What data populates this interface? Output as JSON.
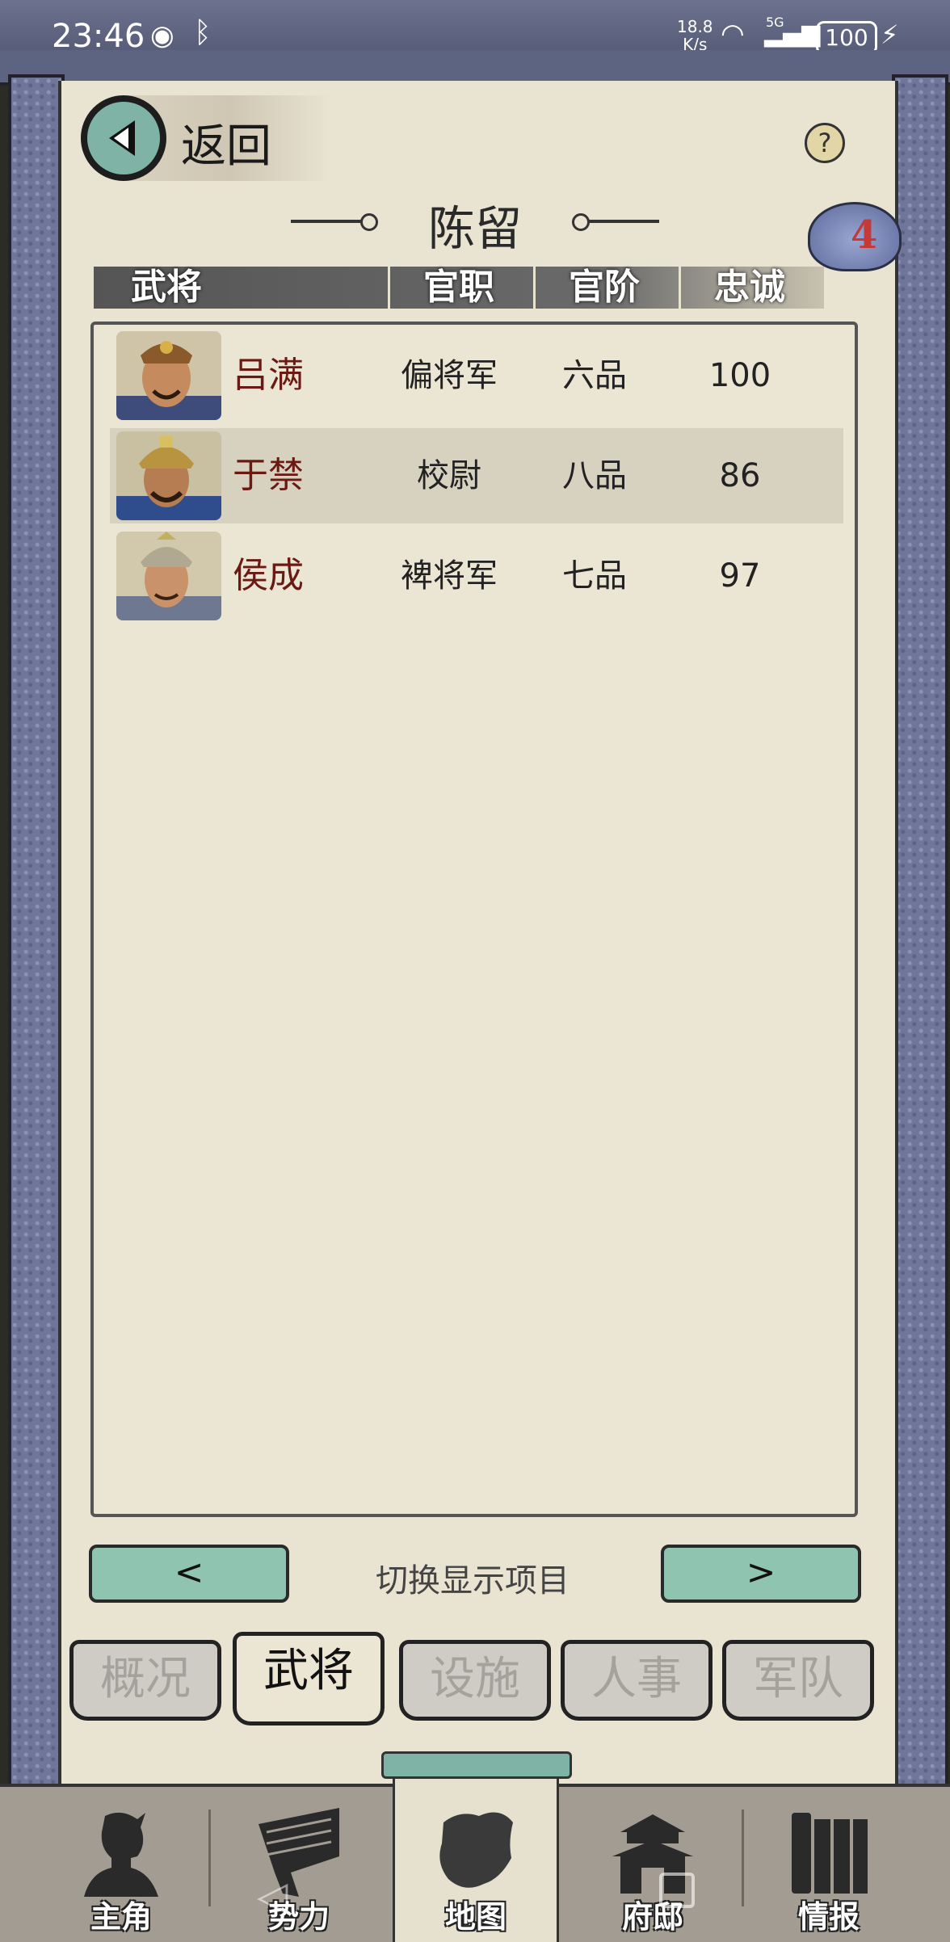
{
  "status_bar": {
    "time": "23:46",
    "net_speed_value": "18.8",
    "net_speed_unit": "K/s",
    "signal_label": "5G",
    "battery": "100"
  },
  "header": {
    "back_label": "返回",
    "help_symbol": "?",
    "city_name": "陈留",
    "badge_count": "4"
  },
  "table": {
    "headers": {
      "general": "武将",
      "post": "官职",
      "rank": "官阶",
      "loyalty": "忠诚"
    },
    "rows": [
      {
        "name": "吕满",
        "post": "偏将军",
        "rank": "六品",
        "loyalty": "100"
      },
      {
        "name": "于禁",
        "post": "校尉",
        "rank": "八品",
        "loyalty": "86"
      },
      {
        "name": "侯成",
        "post": "裨将军",
        "rank": "七品",
        "loyalty": "97"
      }
    ]
  },
  "pager": {
    "prev": "<",
    "next": ">",
    "label": "切换显示项目"
  },
  "tabs": [
    {
      "label": "概况"
    },
    {
      "label": "武将"
    },
    {
      "label": "设施"
    },
    {
      "label": "人事"
    },
    {
      "label": "军队"
    }
  ],
  "bottom_nav": [
    {
      "label": "主角",
      "icon": "hero-icon"
    },
    {
      "label": "势力",
      "icon": "banner-icon"
    },
    {
      "label": "地图",
      "icon": "map-icon"
    },
    {
      "label": "府邸",
      "icon": "mansion-icon"
    },
    {
      "label": "情报",
      "icon": "scroll-icon"
    }
  ],
  "colors": {
    "accent_teal": "#8fc4b0",
    "paper": "#e9e3d2",
    "name_red": "#6a1a12",
    "frame_blue": "#6f7699"
  }
}
